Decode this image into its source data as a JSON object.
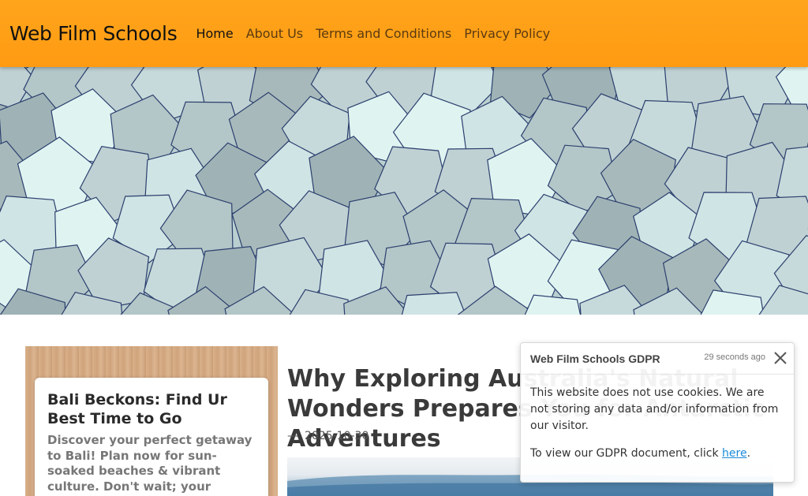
{
  "site": {
    "brand": "Web Film Schools",
    "nav": [
      {
        "label": "Home",
        "active": true
      },
      {
        "label": "About Us",
        "active": false
      },
      {
        "label": "Terms and Conditions",
        "active": false
      },
      {
        "label": "Privacy Policy",
        "active": false
      }
    ]
  },
  "side_post": {
    "title": "Bali Beckons: Find Ur Best Time to Go",
    "excerpt": "Discover your perfect getaway to Bali! Plan now for sun-soaked beaches & vibrant culture. Don't wait; your tropical paradise awaits!"
  },
  "main_post": {
    "title": "Why Exploring Australia's Natural Wonders Prepares You for Antarctic Adventures",
    "dash": "—",
    "date": "2025-10-30"
  },
  "gdpr": {
    "title": "Web Film Schools GDPR",
    "time": "29 seconds ago",
    "body1": "This website does not use cookies. We are not storing any data and/or information from our visitor.",
    "body2_prefix": "To view our GDPR document, click ",
    "link": "here",
    "body2_suffix": "."
  },
  "colors": {
    "header": "#ffa51c",
    "link": "#1a8ad8"
  },
  "icons": {
    "close": "close-icon"
  }
}
